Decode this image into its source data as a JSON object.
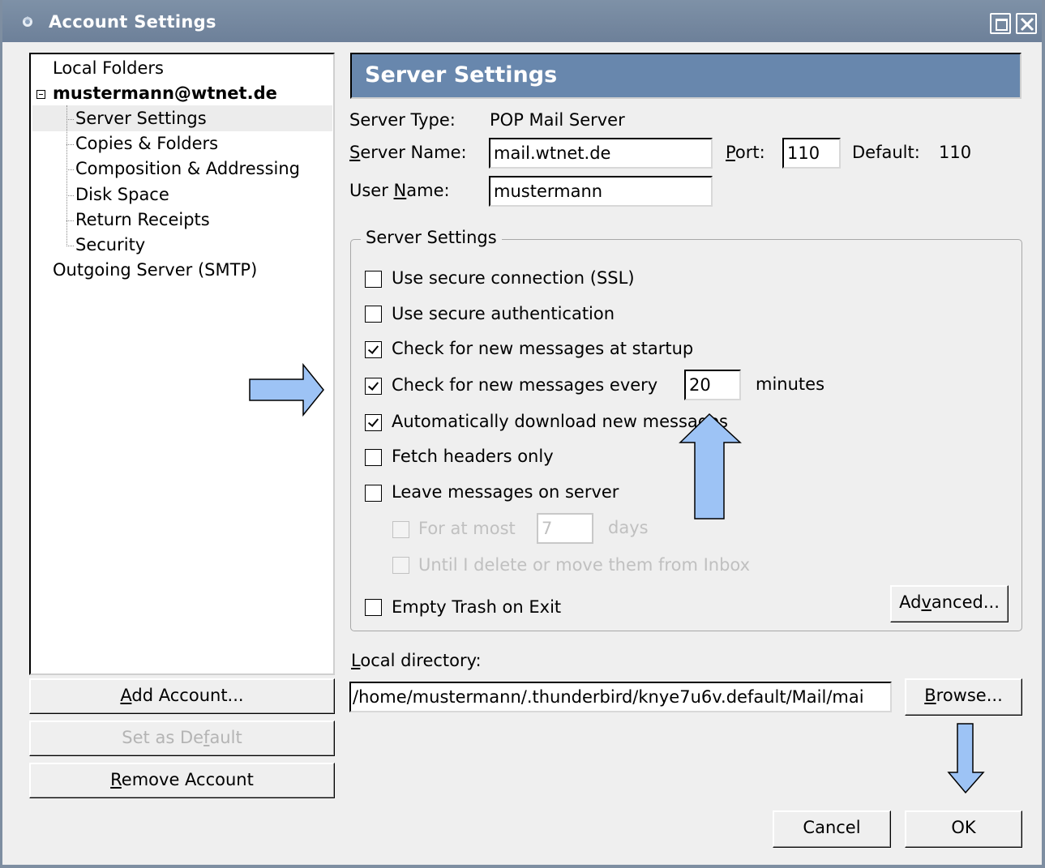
{
  "window": {
    "title": "Account Settings"
  },
  "tree": {
    "items": [
      {
        "label": "Local Folders"
      },
      {
        "label": "mustermann@wtnet.de"
      },
      {
        "label": "Server Settings"
      },
      {
        "label": "Copies & Folders"
      },
      {
        "label": "Composition & Addressing"
      },
      {
        "label": "Disk Space"
      },
      {
        "label": "Return Receipts"
      },
      {
        "label": "Security"
      },
      {
        "label": "Outgoing Server (SMTP)"
      }
    ]
  },
  "left_buttons": {
    "add_account_pre": "",
    "add_account_u": "A",
    "add_account_post": "dd Account...",
    "set_default_pre": "Set as De",
    "set_default_u": "f",
    "set_default_post": "ault",
    "remove_account_pre": "",
    "remove_account_u": "R",
    "remove_account_post": "emove Account"
  },
  "panel": {
    "title": "Server Settings",
    "server_type_label": "Server Type:",
    "server_type_value": "POP Mail Server",
    "server_name_label_u": "S",
    "server_name_label_rest": "erver Name:",
    "server_name_value": "mail.wtnet.de",
    "port_label_u": "P",
    "port_label_rest": "ort:",
    "port_value": "110",
    "default_label": "Default:",
    "default_value": "110",
    "user_name_label_pre": "User ",
    "user_name_label_u": "N",
    "user_name_label_rest": "ame:",
    "user_name_value": "mustermann"
  },
  "group": {
    "title": "Server Settings",
    "ssl": {
      "label": "Use secure connection (SSL)",
      "checked": false
    },
    "secure_auth": {
      "label": "Use secure authentication",
      "checked": false
    },
    "check_startup": {
      "label": "Check for new messages at startup",
      "checked": true
    },
    "check_every": {
      "label": "Check for new messages every",
      "checked": true,
      "value": "20",
      "unit": "minutes"
    },
    "auto_download": {
      "label": "Automatically download new messages",
      "checked": true
    },
    "fetch_headers": {
      "label": "Fetch headers only",
      "checked": false
    },
    "leave_on_server": {
      "label": "Leave messages on server",
      "checked": false
    },
    "for_at_most": {
      "label": "For at most",
      "value": "7",
      "unit": "days",
      "checked": false
    },
    "until_delete": {
      "label": "Until I delete or move them from Inbox",
      "checked": false
    },
    "empty_trash": {
      "label": "Empty Trash on Exit",
      "checked": false
    },
    "advanced_pre": "Ad",
    "advanced_u": "v",
    "advanced_post": "anced..."
  },
  "local_dir": {
    "label_u": "L",
    "label_rest": "ocal directory:",
    "value": "/home/mustermann/.thunderbird/knye7u6v.default/Mail/mai",
    "browse_u": "B",
    "browse_rest": "rowse..."
  },
  "footer": {
    "cancel": "Cancel",
    "ok": "OK"
  },
  "colors": {
    "titlebar": "#6d8099",
    "header": "#6887ad",
    "annotation_arrow": "#9dc3f5"
  }
}
